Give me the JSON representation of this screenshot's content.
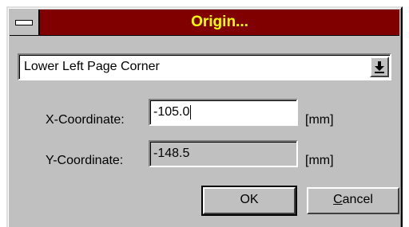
{
  "window": {
    "title": "Origin..."
  },
  "origin_select": {
    "selected": "Lower Left Page Corner"
  },
  "x_coordinate": {
    "label": "X-Coordinate:",
    "value": "-105.0",
    "unit": "[mm]"
  },
  "y_coordinate": {
    "label": "Y-Coordinate:",
    "value": "-148.5",
    "unit": "[mm]"
  },
  "buttons": {
    "ok": "OK",
    "cancel_mnemonic": "C",
    "cancel_rest": "ancel"
  },
  "colors": {
    "titlebar": "#800000",
    "title_text": "#ffff00",
    "face": "#c0c0c0"
  },
  "icons": {
    "system_menu": "system-menu-icon",
    "dropdown": "dropdown-arrow-icon"
  }
}
